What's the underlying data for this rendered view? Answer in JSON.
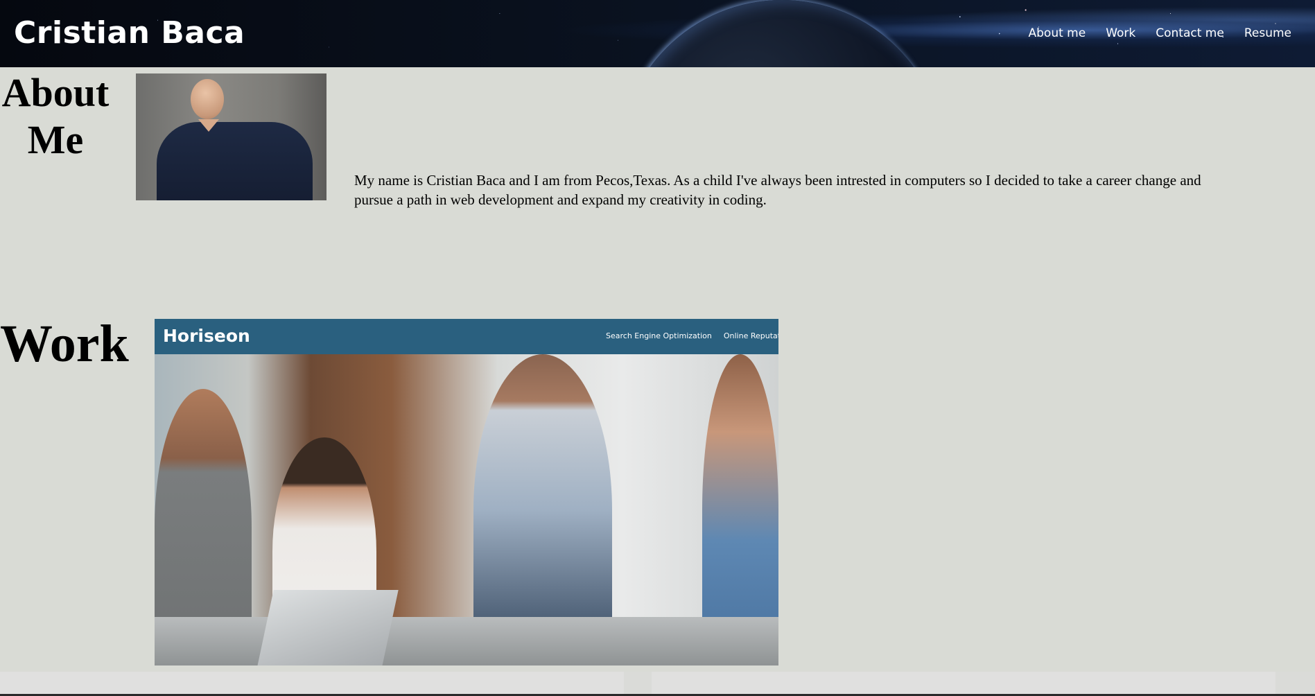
{
  "header": {
    "site_title": "Cristian Baca",
    "nav": [
      {
        "label": "About me"
      },
      {
        "label": "Work"
      },
      {
        "label": "Contact me"
      },
      {
        "label": "Resume"
      }
    ]
  },
  "about": {
    "heading": "About Me",
    "text": "My name is Cristian Baca and I am from Pecos,Texas. As a child I've always been intrested in computers so I decided to take a career change and pursue a path in web development and expand my creativity in coding."
  },
  "work": {
    "heading": "Work",
    "project": {
      "logo": "Horiseon",
      "nav": [
        "Search Engine Optimization",
        "Online Reputation Ma"
      ]
    }
  }
}
